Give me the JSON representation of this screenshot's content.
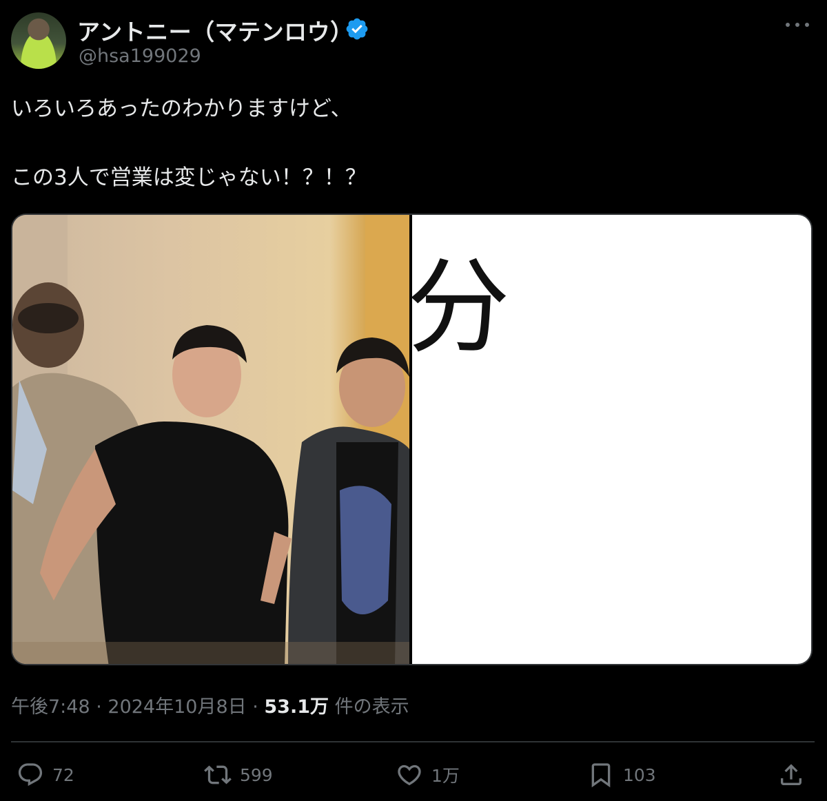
{
  "author": {
    "display_name": "アントニー（マテンロウ）",
    "handle": "@hsa199029",
    "verified": true,
    "verified_color": "#1d9bf0"
  },
  "tweet": {
    "line1": "いろいろあったのわかりますけど、",
    "line2": "この3人で営業は変じゃない！？！？"
  },
  "media": {
    "photo_alt": "photo",
    "panel_text": "分"
  },
  "meta": {
    "time": "午後7:48",
    "dot1": " · ",
    "date": "2024年10月8日",
    "dot2": " · ",
    "views_count": "53.1万",
    "views_label": " 件の表示"
  },
  "actions": {
    "reply_count": "72",
    "retweet_count": "599",
    "like_count": "1万",
    "bookmark_count": "103"
  },
  "colors": {
    "background": "#000000",
    "text_primary": "#e7e9ea",
    "text_secondary": "#71767b",
    "border": "#2f3336"
  }
}
